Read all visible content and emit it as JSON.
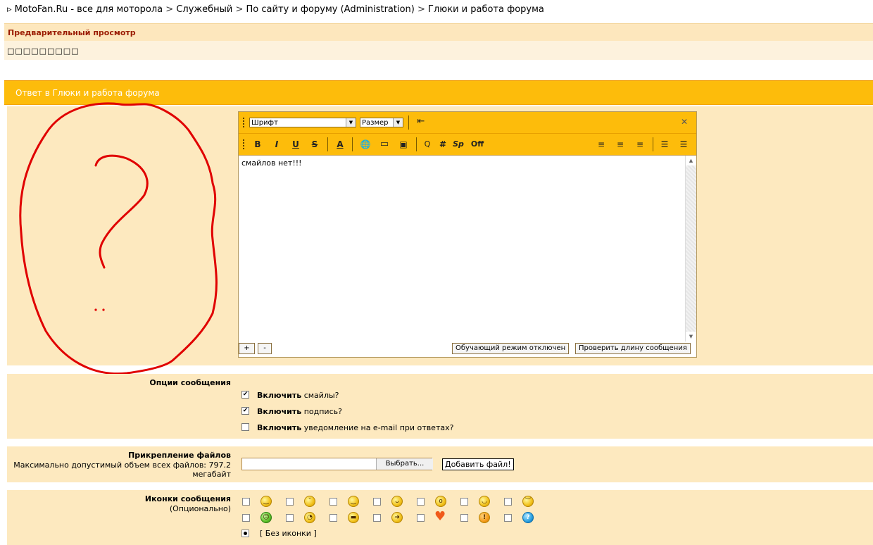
{
  "breadcrumb": {
    "bullet": "▹",
    "items": [
      "MotoFan.Ru - все для моторола",
      "Служебный",
      "По сайту и форуму (Administration)",
      "Глюки и работа форума"
    ],
    "separator": ">"
  },
  "preview": {
    "title": "Предварительный просмотр",
    "content": "□□□□□□□□□"
  },
  "reply": {
    "title": "Ответ в Глюки и работа форума"
  },
  "editor": {
    "font_select": "Шрифт",
    "size_select": "Размер",
    "buttons": {
      "bold": "B",
      "italic": "I",
      "underline": "U",
      "strike": "S",
      "color": "A",
      "sp": "Sp",
      "off": "Off",
      "hash": "#"
    },
    "text": "смайлов нет!!!",
    "expand_label": "+",
    "shrink_label": "-",
    "training_mode": "Обучающий режим отключен",
    "check_length": "Проверить длину сообщения"
  },
  "options": {
    "title": "Опции сообщения",
    "items": [
      {
        "bold": "Включить",
        "rest": "смайлы?",
        "checked": true,
        "mark": "✔"
      },
      {
        "bold": "Включить",
        "rest": "подпись?",
        "checked": true,
        "mark": "✔"
      },
      {
        "bold": "Включить",
        "rest": "уведомление на e-mail при ответах?",
        "checked": false,
        "mark": ""
      }
    ]
  },
  "attachments": {
    "title": "Прикрепление файлов",
    "description_line1": "Максимально допустимый объем всех файлов: 797.2",
    "description_line2": "мегабайт",
    "browse": "Выбрать...",
    "add_file": "Добавить файл!"
  },
  "icons": {
    "title": "Иконки сообщения",
    "subtitle": "(Опционально)",
    "row1": [
      "smile-icon",
      "wink-icon",
      "sleepy-icon",
      "tongue-icon",
      "shocked-icon",
      "grin-icon",
      "angry-icon"
    ],
    "row2": [
      "green-face-icon",
      "worried-icon",
      "sunglasses-icon",
      "arrow-right-icon",
      "heart-icon",
      "exclamation-icon",
      "question-icon"
    ],
    "none_label": "[ Без иконки ]"
  },
  "colors": {
    "header_orange": "#fdbc0b",
    "panel_beige": "#fde9bf",
    "preview_title_red": "#9a1b00",
    "annotation_red": "#e00000"
  }
}
